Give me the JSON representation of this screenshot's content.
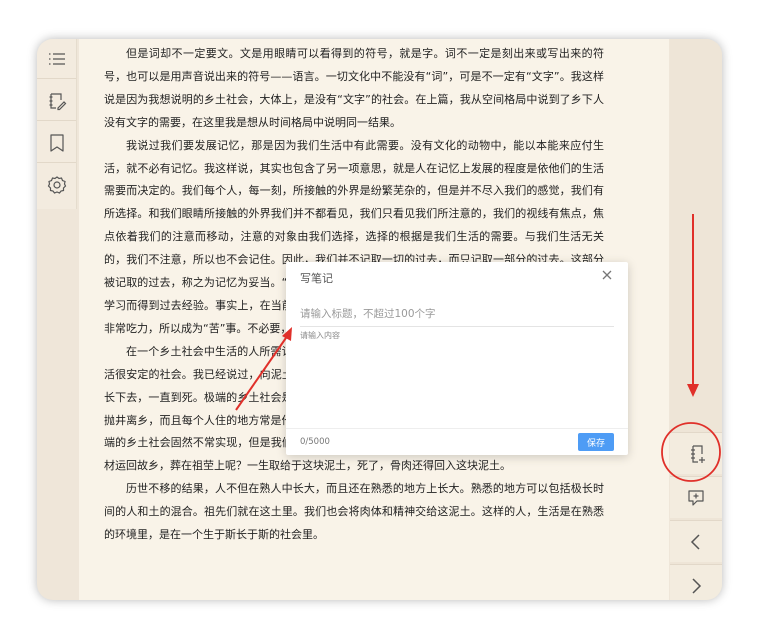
{
  "sidebar_left": {
    "items": [
      {
        "name": "toc",
        "icon": "list-icon"
      },
      {
        "name": "notes",
        "icon": "note-edit-icon"
      },
      {
        "name": "bookmark",
        "icon": "bookmark-icon"
      },
      {
        "name": "settings",
        "icon": "gear-icon"
      }
    ]
  },
  "sidebar_right": {
    "items": [
      {
        "name": "add-note",
        "icon": "note-add-icon"
      },
      {
        "name": "add-comment",
        "icon": "comment-add-icon"
      },
      {
        "name": "prev",
        "icon": "chevron-left-icon"
      },
      {
        "name": "next",
        "icon": "chevron-right-icon"
      }
    ]
  },
  "article": {
    "paragraphs": [
      "但是词却不一定要文。文是用眼睛可以看得到的符号，就是字。词不一定是刻出来或写出来的符号，也可以是用声音说出来的符号——语言。一切文化中不能没有“词”，可是不一定有“文字”。我这样说是因为我想说明的乡土社会，大体上，是没有“文字”的社会。在上篇，我从空间格局中说到了乡下人没有文字的需要，在这里我是想从时间格局中说明同一结果。",
      "我说过我们要发展记忆，那是因为我们生活中有此需要。没有文化的动物中，能以本能来应付生活，就不必有记忆。我这样说，其实也包含了另一项意思，就是人在记忆上发展的程度是依他们的生活需要而决定的。我们每个人，每一刻，所接触的外界是纷繁芜杂的，但是并不尽入我们的感觉，我们有所选择。和我们眼睛所接触的外界我们并不都看见，我们只看见我们所注意的，我们的视线有焦点，焦点依着我们的注意而移动，注意的对象由我们选择，选择的根据是我们生活的需要。与我们生活无关的，我们不注意，所以也不会记住。因此，我们并不记取一切的过去，而只记取一部分的过去。这部分被记取的过去，称之为记忆为妥当。“记”带有在当前心理上有所有意保留的成分，所以记忆是借我们的学习而得到过去经验。事实上，在当前的生活中，我们时常是为了将来才去追忆过去的。这种学习过程非常吃力，所以成为“苦”事。不必要，我们是不肯去学习的。这就是所谓教育的生活。",
      "在一个乡土社会中生活的人所需记忆的范围和生活在现代都市中的人是不同的。乡土社会是一个生活很安定的社会。我已经说过，向泥土讨生活的人是不能老是移动的。在一个地方出生的就在这地方生长下去，一直到死。极端的乡土社会是老子所理想的社会，“鸡犬相闻，老死不相往来”。不但个人不常抛井离乡，而且每个人住的地方常是他的父母之邦。“生于斯，死于斯”的结果必是世代的黏着。这种极端的乡土社会固然不常实现，但是我们的确有历世不移的企图，不然为什么死在外边的人，一定要把棺材运回故乡，葬在祖茔上呢？一生取给于这块泥土，死了，骨肉还得回入这块泥土。",
      "历世不移的结果，人不但在熟人中长大，而且还在熟悉的地方上长大。熟悉的地方可以包括极长时间的人和土的混合。祖先们就在这土里。我们也会将肉体和精神交给这泥土。这样的人，生活是在熟悉的环境里，是在一个生于斯长于斯的社会里。"
    ]
  },
  "modal": {
    "title": "写笔记",
    "title_placeholder": "请输入标题，不超过100个字",
    "content_placeholder": "请输入内容",
    "counter": "0/5000",
    "save_label": "保存"
  },
  "colors": {
    "annotation_red": "#e0302a",
    "save_blue": "#4e9cf5",
    "page_bg": "#f9f3e8"
  }
}
